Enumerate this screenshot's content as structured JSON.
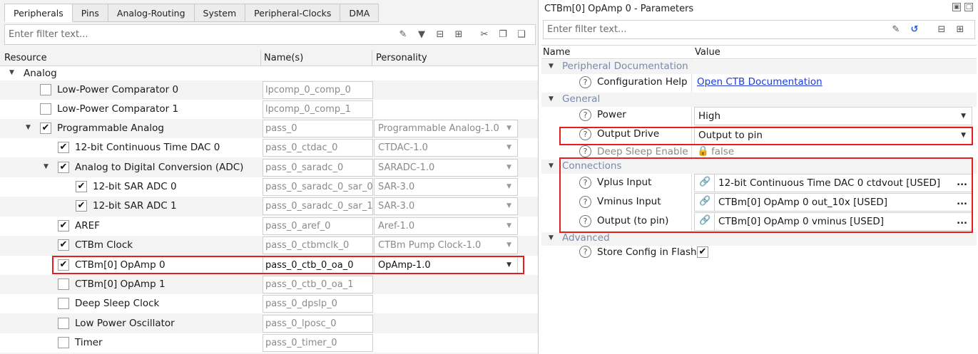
{
  "left": {
    "tabs": [
      "Peripherals",
      "Pins",
      "Analog-Routing",
      "System",
      "Peripheral-Clocks",
      "DMA"
    ],
    "filter_placeholder": "Enter filter text...",
    "columns": {
      "resource": "Resource",
      "names": "Name(s)",
      "personality": "Personality"
    },
    "tree_root": "Analog",
    "rows": [
      {
        "label": "Low-Power Comparator 0",
        "checked": false,
        "name": "lpcomp_0_comp_0",
        "personality": ""
      },
      {
        "label": "Low-Power Comparator 1",
        "checked": false,
        "name": "lpcomp_0_comp_1",
        "personality": ""
      },
      {
        "label": "Programmable Analog",
        "checked": true,
        "name": "pass_0",
        "personality": "Programmable Analog-1.0"
      },
      {
        "label": "12-bit Continuous Time DAC 0",
        "checked": true,
        "name": "pass_0_ctdac_0",
        "personality": "CTDAC-1.0"
      },
      {
        "label": "Analog to Digital Conversion (ADC)",
        "checked": true,
        "name": "pass_0_saradc_0",
        "personality": "SARADC-1.0"
      },
      {
        "label": "12-bit SAR ADC 0",
        "checked": true,
        "name": "pass_0_saradc_0_sar_0",
        "personality": "SAR-3.0"
      },
      {
        "label": "12-bit SAR ADC 1",
        "checked": true,
        "name": "pass_0_saradc_0_sar_1",
        "personality": "SAR-3.0"
      },
      {
        "label": "AREF",
        "checked": true,
        "name": "pass_0_aref_0",
        "personality": "Aref-1.0"
      },
      {
        "label": "CTBm Clock",
        "checked": true,
        "name": "pass_0_ctbmclk_0",
        "personality": "CTBm Pump Clock-1.0"
      },
      {
        "label": "CTBm[0] OpAmp 0",
        "checked": true,
        "name": "pass_0_ctb_0_oa_0",
        "personality": "OpAmp-1.0"
      },
      {
        "label": "CTBm[0] OpAmp 1",
        "checked": false,
        "name": "pass_0_ctb_0_oa_1",
        "personality": ""
      },
      {
        "label": "Deep Sleep Clock",
        "checked": false,
        "name": "pass_0_dpslp_0",
        "personality": ""
      },
      {
        "label": "Low Power Oscillator",
        "checked": false,
        "name": "pass_0_lposc_0",
        "personality": ""
      },
      {
        "label": "Timer",
        "checked": false,
        "name": "pass_0_timer_0",
        "personality": ""
      }
    ]
  },
  "right": {
    "title": "CTBm[0] OpAmp 0 - Parameters",
    "filter_placeholder": "Enter filter text...",
    "columns": {
      "name": "Name",
      "value": "Value"
    },
    "categories": {
      "doc": "Peripheral Documentation",
      "general": "General",
      "connections": "Connections",
      "advanced": "Advanced"
    },
    "params": {
      "config_help": {
        "label": "Configuration Help",
        "value": "Open CTB Documentation"
      },
      "power": {
        "label": "Power",
        "value": "High"
      },
      "output_drive": {
        "label": "Output Drive",
        "value": "Output to pin"
      },
      "deep_sleep": {
        "label": "Deep Sleep Enable",
        "value": "false"
      },
      "vplus": {
        "label": "Vplus Input",
        "value": "12-bit Continuous Time DAC 0 ctdvout [USED]"
      },
      "vminus": {
        "label": "Vminus Input",
        "value": "CTBm[0] OpAmp 0 out_10x [USED]"
      },
      "output_pin": {
        "label": "Output (to pin)",
        "value": "CTBm[0] OpAmp 0 vminus [USED]"
      },
      "store_config": {
        "label": "Store Config in Flash",
        "checked": true
      }
    },
    "ellipsis": "..."
  },
  "colors": {
    "highlight": "#e51d1d",
    "link": "#1f3bd6"
  }
}
